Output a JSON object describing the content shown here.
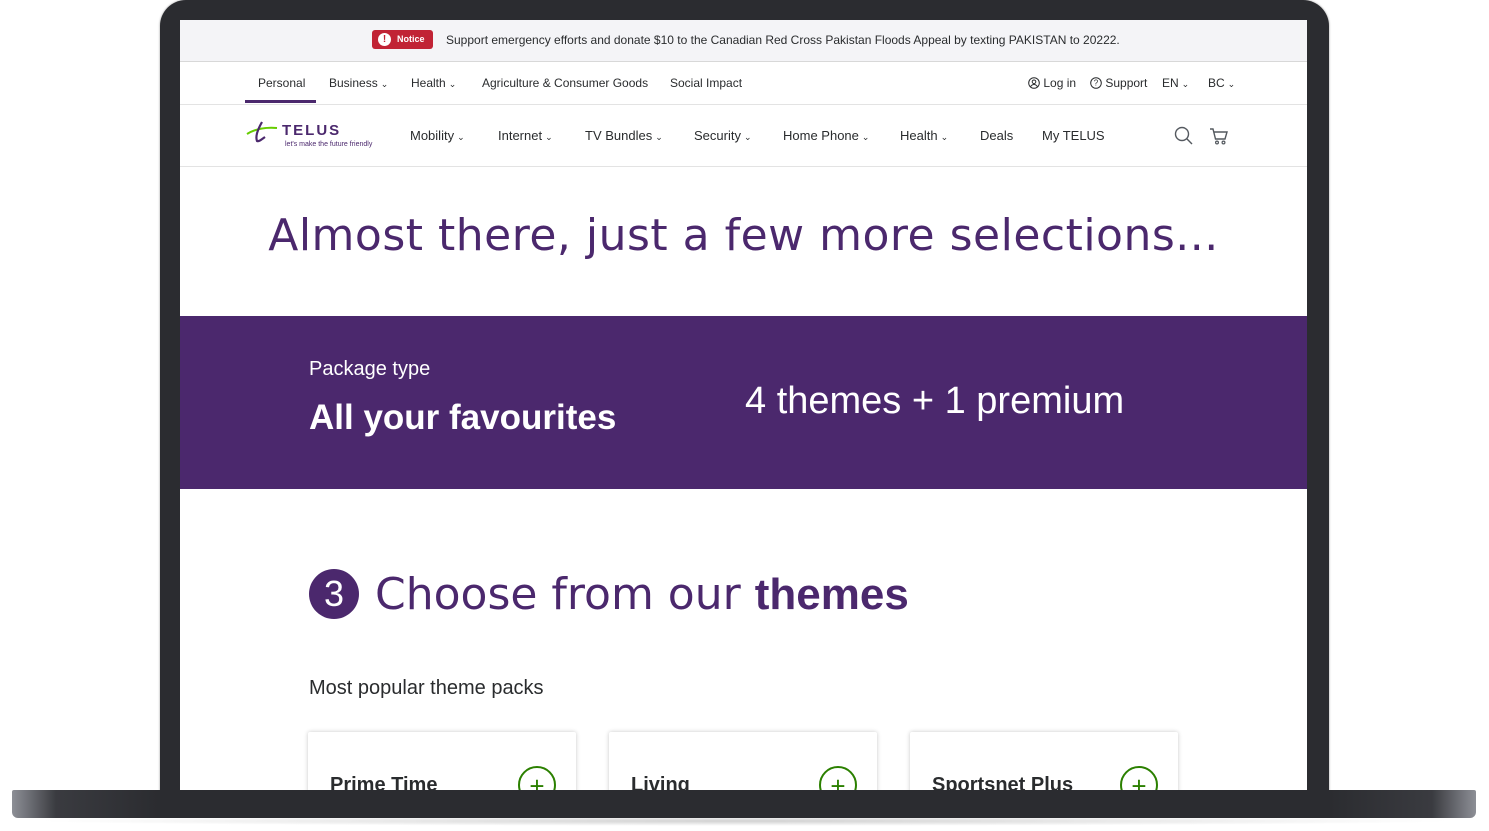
{
  "notice": {
    "badge": "Notice",
    "text": "Support emergency efforts and donate $10 to the Canadian Red Cross Pakistan Floods Appeal by texting PAKISTAN to 20222."
  },
  "topnav": {
    "items": [
      "Personal",
      "Business",
      "Health",
      "Agriculture & Consumer Goods",
      "Social Impact"
    ],
    "active": "Personal",
    "right": {
      "login": "Log in",
      "support": "Support",
      "language": "EN",
      "region": "BC"
    }
  },
  "mainnav": {
    "logo": {
      "word": "TELUS",
      "tagline": "let's make the future friendly"
    },
    "items": [
      "Mobility",
      "Internet",
      "TV Bundles",
      "Security",
      "Home Phone",
      "Health",
      "Deals",
      "My TELUS"
    ],
    "icons": [
      "search-icon",
      "cart-icon"
    ]
  },
  "hero": {
    "title": "Almost there, just a few more selections..."
  },
  "package": {
    "label": "Package type",
    "name": "All your favourites",
    "count": "4 themes + 1 premium"
  },
  "step": {
    "number": "3",
    "title_prefix": "Choose from our",
    "title_bold": "themes",
    "subtitle": "Most popular theme packs"
  },
  "cards": [
    {
      "name": "Prime Time",
      "action": "+"
    },
    {
      "name": "Living",
      "action": "+"
    },
    {
      "name": "Sportsnet Plus",
      "action": "+"
    }
  ],
  "colors": {
    "brand_purple": "#4b286d",
    "notice_red": "#c12335",
    "action_green": "#2b8000"
  }
}
